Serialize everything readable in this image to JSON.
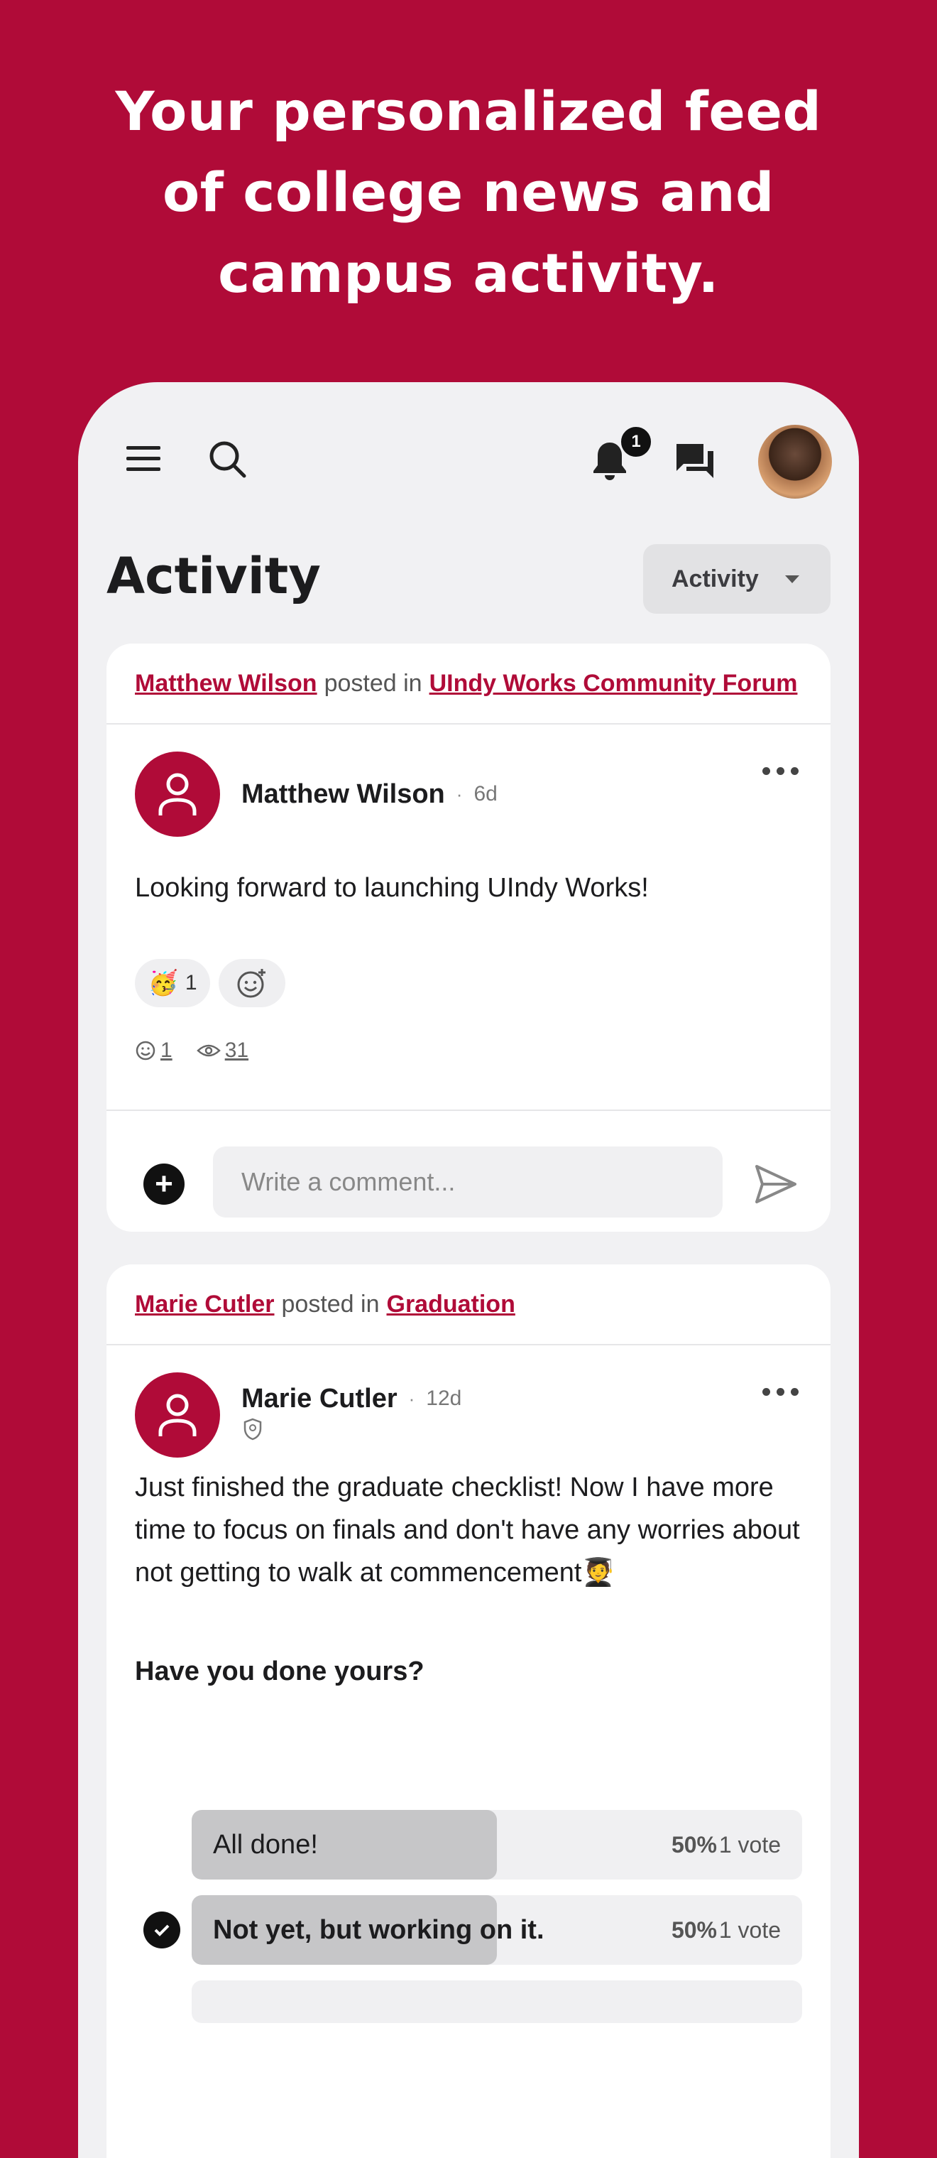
{
  "headline": {
    "line1": "Your personalized feed",
    "line2": "of college news and",
    "line3": "campus activity."
  },
  "colors": {
    "brand": "#B00B38",
    "phone_bg": "#F1F1F3",
    "card_bg": "#FFFFFF"
  },
  "topbar": {
    "notification_count": "1",
    "icons": [
      "menu-icon",
      "search-icon",
      "bell-icon",
      "chat-icon",
      "avatar"
    ]
  },
  "page": {
    "title": "Activity",
    "filter_label": "Activity"
  },
  "posts": [
    {
      "posted_by": "Matthew Wilson",
      "posted_in_text": "posted in",
      "group": "UIndy Works Community Forum",
      "author": "Matthew Wilson",
      "time": "6d",
      "body": "Looking forward to launching UIndy Works!",
      "reaction_emoji": "🥳",
      "reaction_count": "1",
      "reactions_stat": "1",
      "views_stat": "31",
      "comment_placeholder": "Write a comment..."
    },
    {
      "posted_by": "Marie Cutler",
      "posted_in_text": "posted in",
      "group": "Graduation",
      "author": "Marie Cutler",
      "time": "12d",
      "body": "Just finished the graduate checklist! Now I have more time to focus on finals and don't have any worries about not getting to walk at commencement🧑‍🎓",
      "poll_question": "Have you done yours?",
      "poll_options": [
        {
          "label": "All done!",
          "percent_text": "50%",
          "votes": "1 vote",
          "fraction": 0.5,
          "selected": false
        },
        {
          "label": "Not yet, but working on it.",
          "percent_text": "50%",
          "votes": "1 vote",
          "fraction": 0.5,
          "selected": true
        }
      ]
    }
  ]
}
